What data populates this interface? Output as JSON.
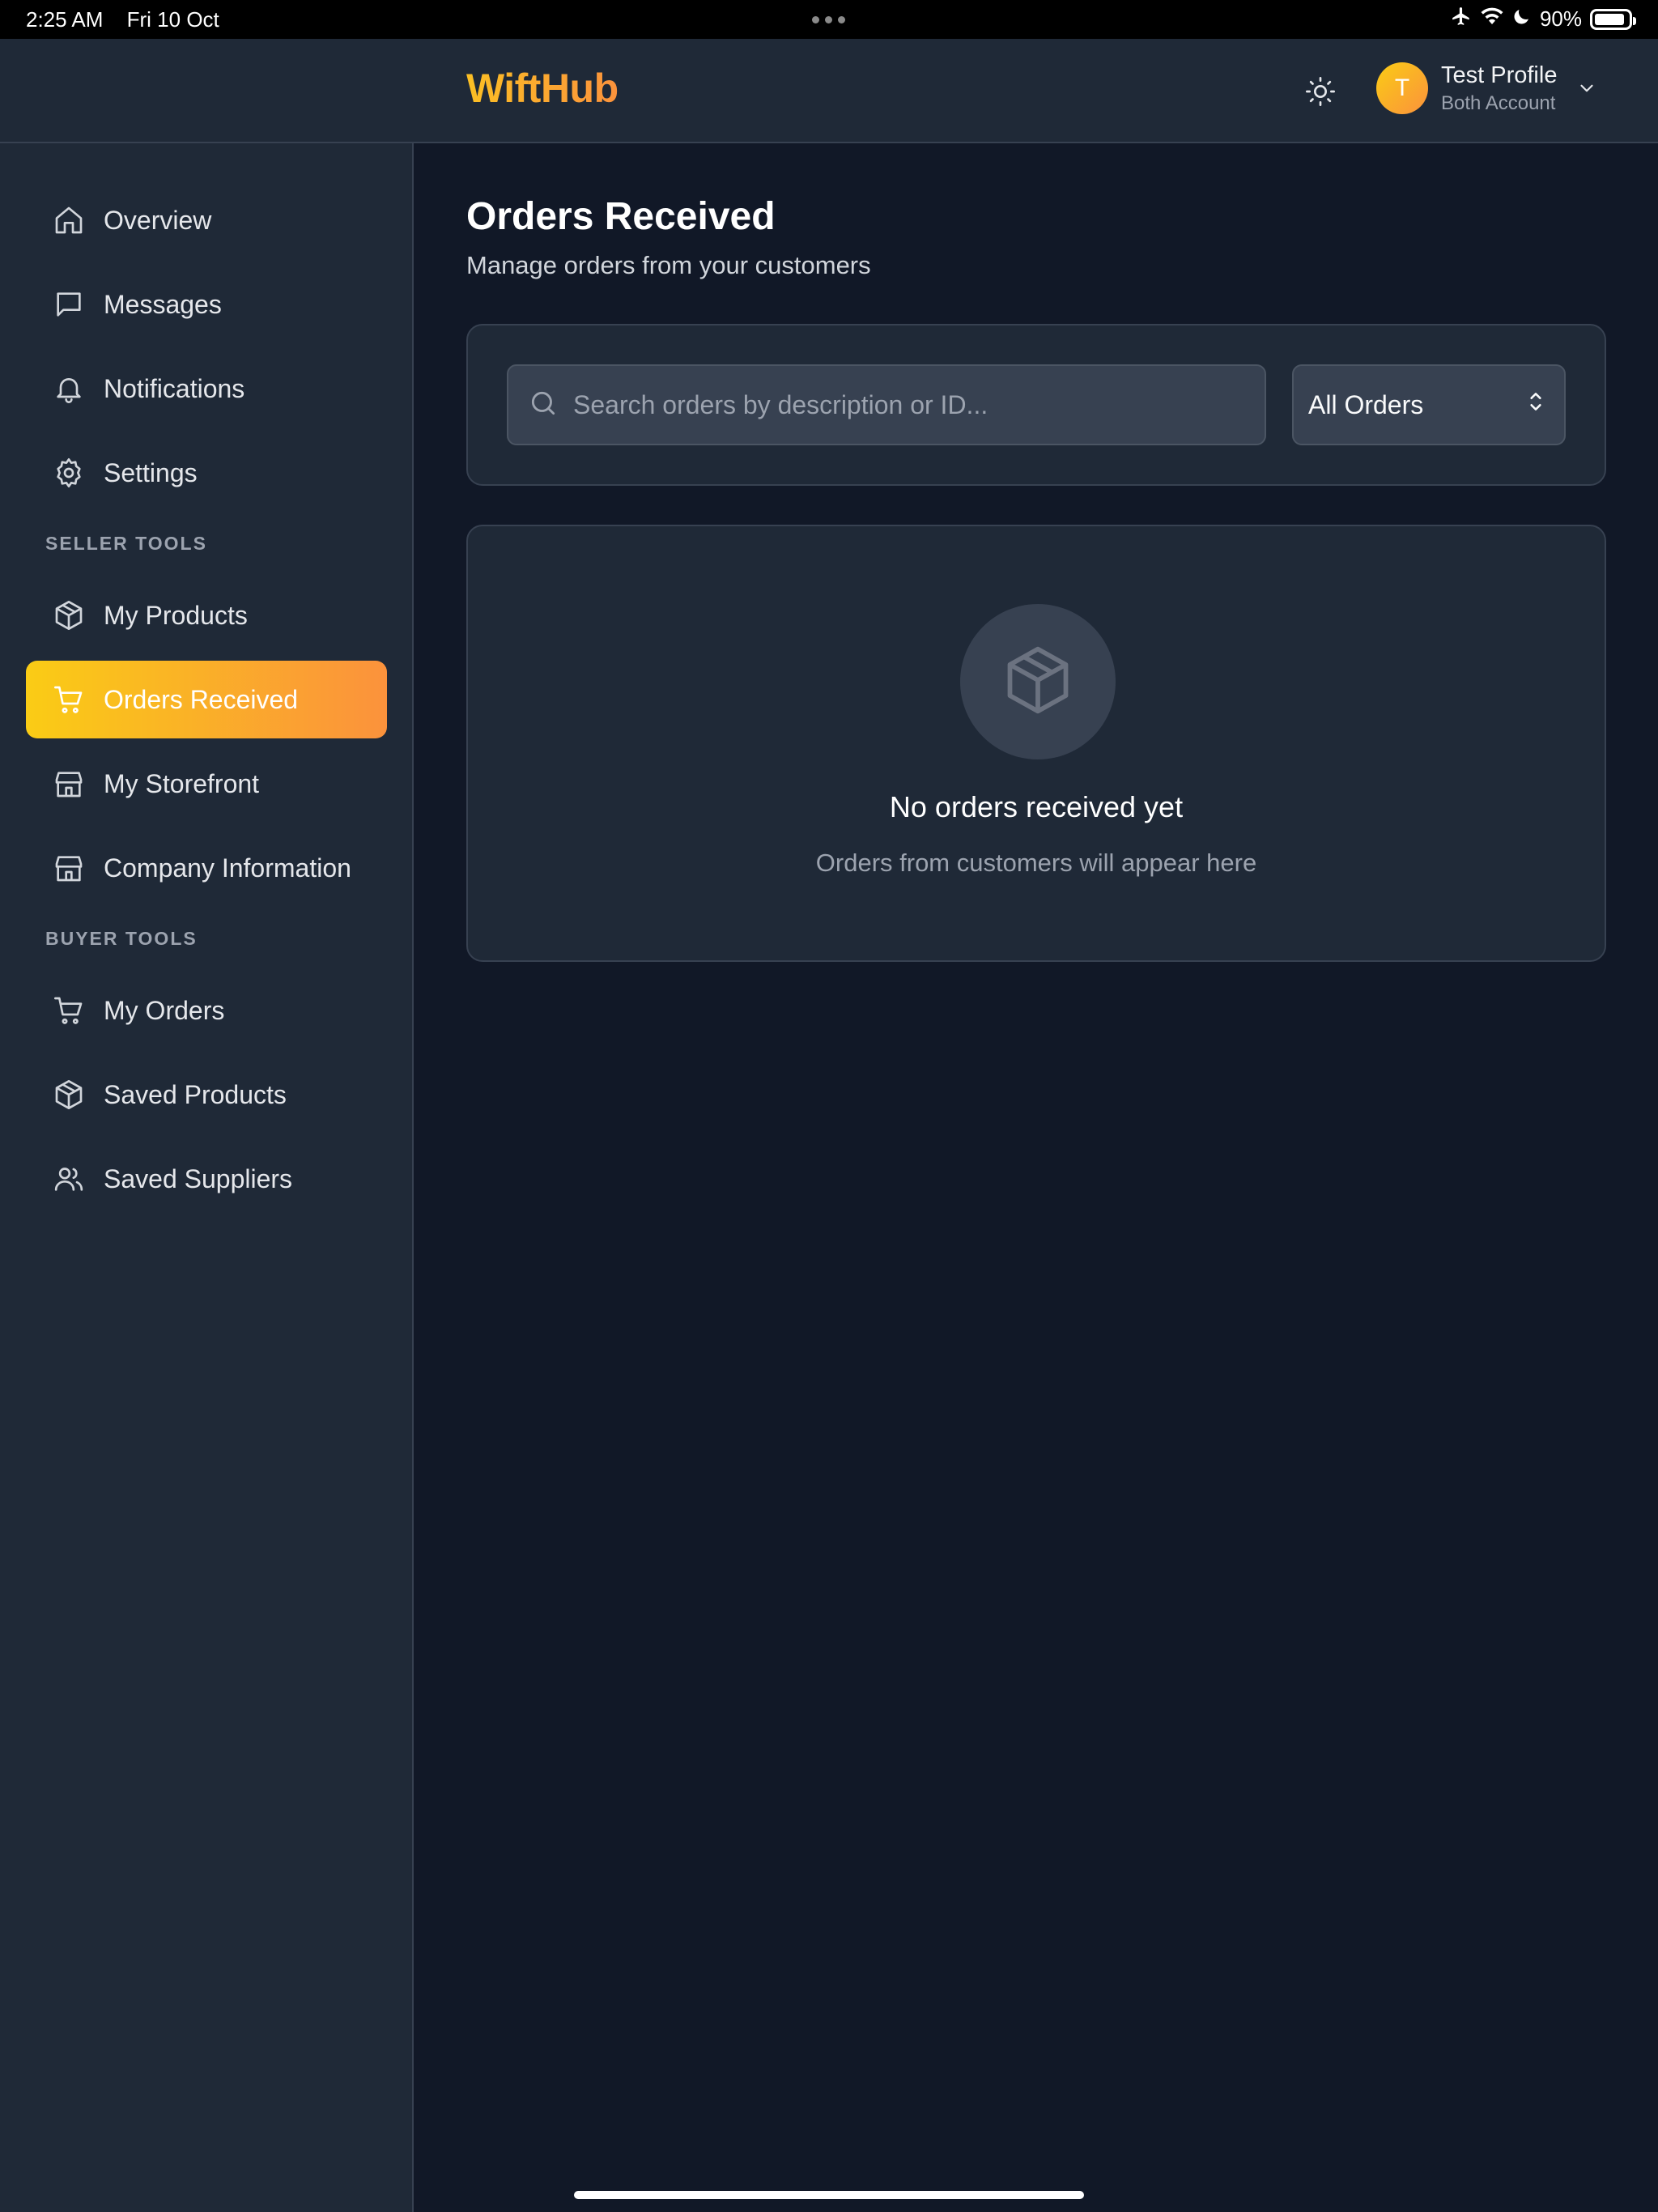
{
  "status_bar": {
    "time": "2:25 AM",
    "date": "Fri 10 Oct",
    "battery": "90%",
    "battery_level": 0.9,
    "icons": [
      "airplane-icon",
      "wifi-icon",
      "moon-icon",
      "battery-icon"
    ]
  },
  "header": {
    "logo": "WiftHub",
    "profile": {
      "initial": "T",
      "name": "Test Profile",
      "account_type": "Both Account"
    }
  },
  "sidebar": {
    "items_top": [
      {
        "label": "Overview",
        "icon": "home-icon"
      },
      {
        "label": "Messages",
        "icon": "message-icon"
      },
      {
        "label": "Notifications",
        "icon": "bell-icon"
      },
      {
        "label": "Settings",
        "icon": "gear-icon"
      }
    ],
    "seller_label": "SELLER TOOLS",
    "seller_items": [
      {
        "label": "My Products",
        "icon": "package-icon"
      },
      {
        "label": "Orders Received",
        "icon": "cart-icon",
        "active": true
      },
      {
        "label": "My Storefront",
        "icon": "store-icon"
      },
      {
        "label": "Company Information",
        "icon": "store-icon"
      }
    ],
    "buyer_label": "BUYER TOOLS",
    "buyer_items": [
      {
        "label": "My Orders",
        "icon": "cart-icon"
      },
      {
        "label": "Saved Products",
        "icon": "package-icon"
      },
      {
        "label": "Saved Suppliers",
        "icon": "users-icon"
      }
    ]
  },
  "main": {
    "title": "Orders Received",
    "subtitle": "Manage orders from your customers",
    "search": {
      "placeholder": "Search orders by description or ID...",
      "value": ""
    },
    "filter": {
      "selected": "All Orders"
    },
    "empty_state": {
      "icon": "package-icon",
      "title": "No orders received yet",
      "message": "Orders from customers will appear here"
    }
  },
  "colors": {
    "accent_start": "#facc15",
    "accent_end": "#fb923c",
    "background": "#111827",
    "panel": "#1f2937"
  }
}
